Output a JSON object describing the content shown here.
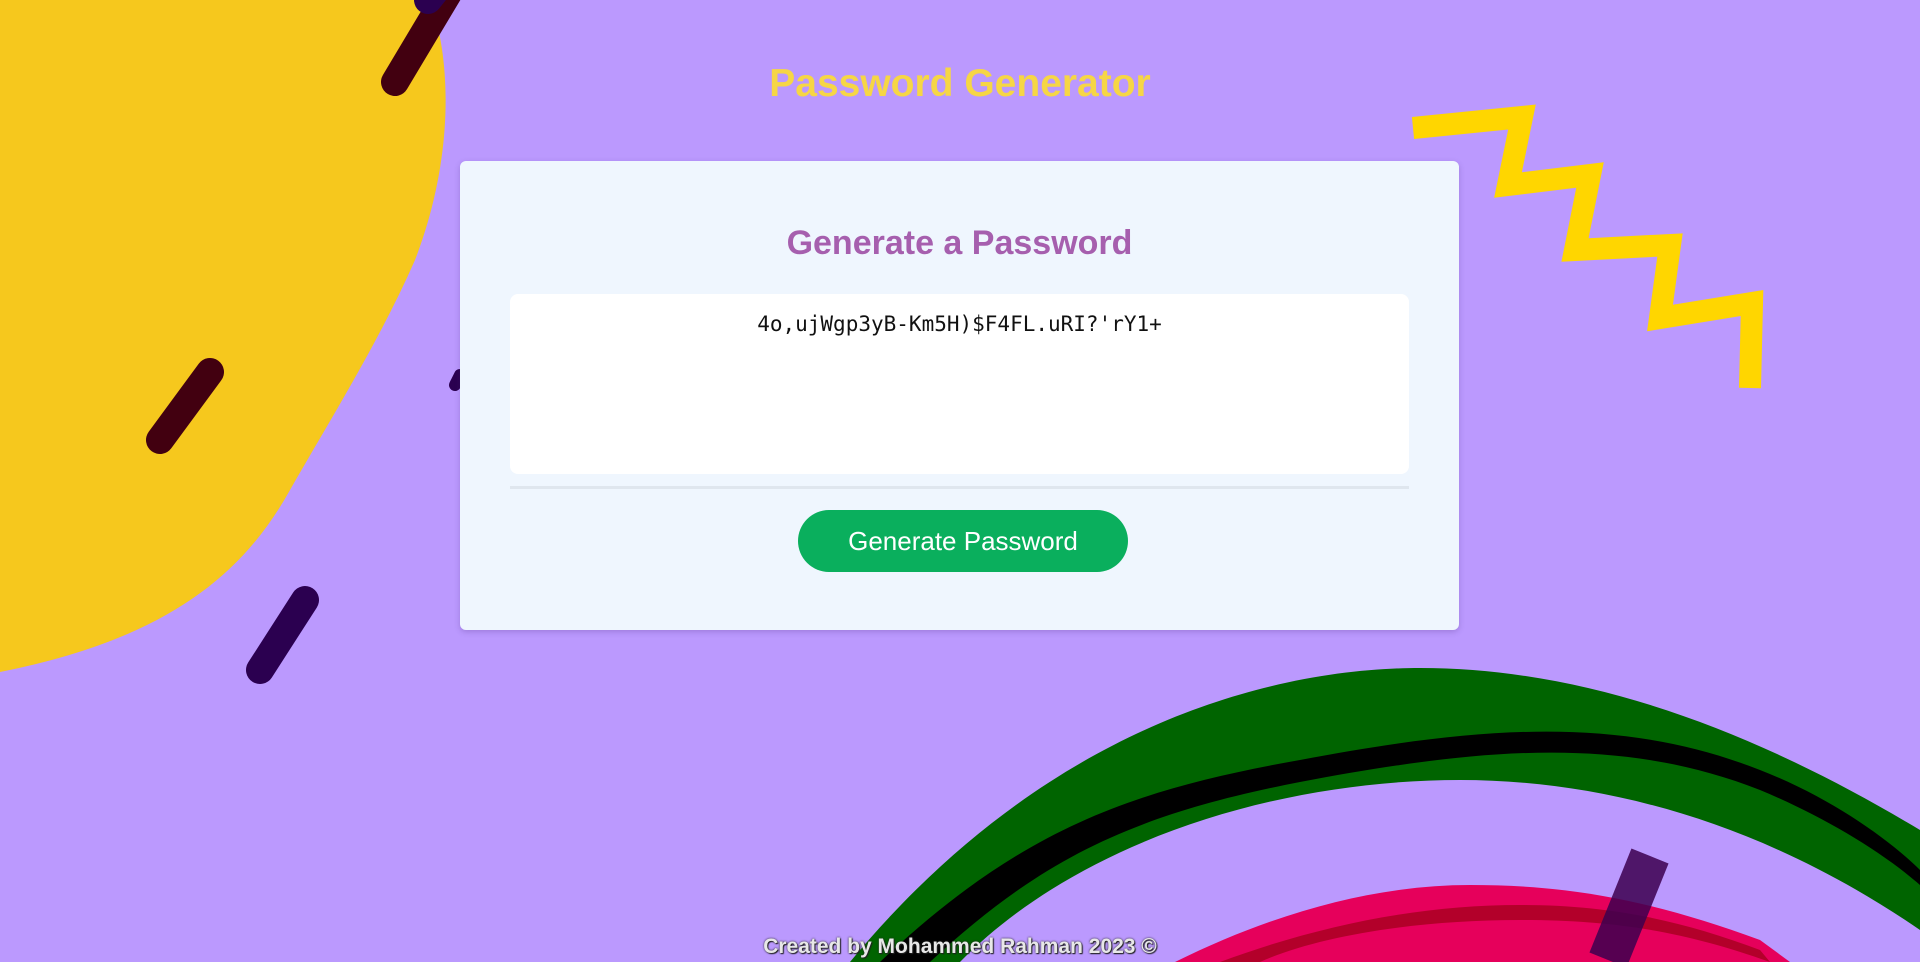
{
  "header": {
    "title": "Password Generator"
  },
  "card": {
    "title": "Generate a Password",
    "password_value": "4o,ujWgp3yB-Km5H)$F4FL.uRI?'rY1+",
    "button_label": "Generate Password"
  },
  "footer": {
    "credit": "Created by Mohammed Rahman 2023 ©"
  },
  "colors": {
    "background": "#bb99fe",
    "title": "#f6d645",
    "card_title": "#a65fae",
    "card_background": "#eff6fe",
    "button": "#0aaf5d",
    "blob_yellow": "#f6c81d",
    "zigzag_yellow": "#ffd600",
    "wave_green": "#006400",
    "wave_pink": "#e6005b"
  },
  "decorations": {
    "background_shapes": [
      "yellow-blob",
      "dark-dashes",
      "yellow-zigzag",
      "green-wave",
      "pink-wave"
    ]
  }
}
